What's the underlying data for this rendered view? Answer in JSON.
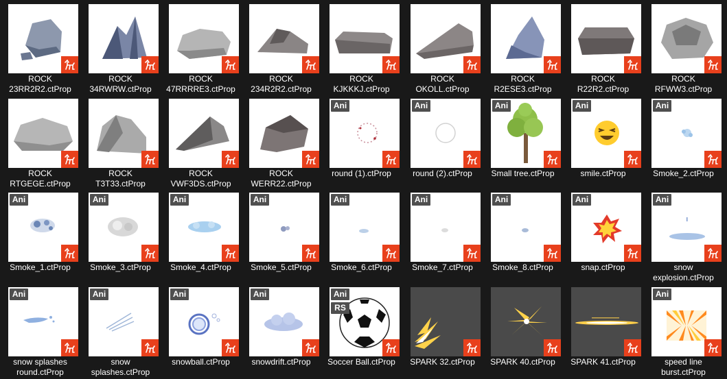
{
  "colors": {
    "background": "#191919",
    "thumb": "#ffffff",
    "badge": "#4f4f4f",
    "logo": "#e8401c"
  },
  "items": [
    {
      "lines": [
        "ROCK",
        "23RR2R2.ctProp"
      ],
      "icon": "rock-icon",
      "art": "rock1"
    },
    {
      "lines": [
        "ROCK",
        "34RWRW.ctProp"
      ],
      "icon": "rock-icon",
      "art": "rock2"
    },
    {
      "lines": [
        "ROCK",
        "47RRRRE3.ctProp"
      ],
      "icon": "rock-icon",
      "art": "rock3"
    },
    {
      "lines": [
        "ROCK",
        "234R2R2.ctProp"
      ],
      "icon": "rock-icon",
      "art": "rock4"
    },
    {
      "lines": [
        "ROCK",
        "KJKKKJ.ctProp"
      ],
      "icon": "rock-icon",
      "art": "rock5"
    },
    {
      "lines": [
        "ROCK",
        "OKOLL.ctProp"
      ],
      "icon": "rock-icon",
      "art": "rock6"
    },
    {
      "lines": [
        "ROCK",
        "R2ESE3.ctProp"
      ],
      "icon": "rock-icon",
      "art": "rock7"
    },
    {
      "lines": [
        "ROCK",
        "R22R2.ctProp"
      ],
      "icon": "rock-icon",
      "art": "rock8"
    },
    {
      "lines": [
        "ROCK",
        "RFWW3.ctProp"
      ],
      "icon": "rock-icon",
      "art": "rock9"
    },
    {
      "lines": [
        "ROCK",
        "RTGEGE.ctProp"
      ],
      "icon": "rock-icon",
      "art": "rock10"
    },
    {
      "lines": [
        "ROCK",
        "T3T33.ctProp"
      ],
      "icon": "rock-icon",
      "art": "rock11"
    },
    {
      "lines": [
        "ROCK",
        "VWF3DS.ctProp"
      ],
      "icon": "rock-icon",
      "art": "rock12"
    },
    {
      "lines": [
        "ROCK",
        "WERR22.ctProp"
      ],
      "icon": "rock-icon",
      "art": "rock13"
    },
    {
      "lines": [
        "round (1).ctProp"
      ],
      "badges": [
        "Ani"
      ],
      "icon": "dotted-circle-icon",
      "art": "round1"
    },
    {
      "lines": [
        "round (2).ctProp"
      ],
      "badges": [
        "Ani"
      ],
      "icon": "circle-icon",
      "art": "round2"
    },
    {
      "lines": [
        "Small tree.ctProp"
      ],
      "badges": [
        "Ani"
      ],
      "icon": "tree-icon",
      "art": "tree"
    },
    {
      "lines": [
        "smile.ctProp"
      ],
      "badges": [
        "Ani"
      ],
      "icon": "smile-icon",
      "art": "smile"
    },
    {
      "lines": [
        "Smoke_2.ctProp"
      ],
      "badges": [
        "Ani"
      ],
      "icon": "smoke-icon",
      "art": "smoke2"
    },
    {
      "lines": [
        "Smoke_1.ctProp"
      ],
      "badges": [
        "Ani"
      ],
      "icon": "smoke-icon",
      "art": "smoke1"
    },
    {
      "lines": [
        "Smoke_3.ctProp"
      ],
      "badges": [
        "Ani"
      ],
      "icon": "smoke-icon",
      "art": "smoke3"
    },
    {
      "lines": [
        "Smoke_4.ctProp"
      ],
      "badges": [
        "Ani"
      ],
      "icon": "smoke-icon",
      "art": "smoke4"
    },
    {
      "lines": [
        "Smoke_5.ctProp"
      ],
      "badges": [
        "Ani"
      ],
      "icon": "smoke-icon",
      "art": "smoke5"
    },
    {
      "lines": [
        "Smoke_6.ctProp"
      ],
      "badges": [
        "Ani"
      ],
      "icon": "smoke-icon",
      "art": "smoke6"
    },
    {
      "lines": [
        "Smoke_7.ctProp"
      ],
      "badges": [
        "Ani"
      ],
      "icon": "smoke-icon",
      "art": "smoke7"
    },
    {
      "lines": [
        "Smoke_8.ctProp"
      ],
      "badges": [
        "Ani"
      ],
      "icon": "smoke-icon",
      "art": "smoke8"
    },
    {
      "lines": [
        "snap.ctProp"
      ],
      "badges": [
        "Ani"
      ],
      "icon": "snap-burst-icon",
      "art": "snap"
    },
    {
      "lines": [
        "snow",
        "explosion.ctProp"
      ],
      "badges": [
        "Ani"
      ],
      "icon": "snow-icon",
      "art": "snowexp"
    },
    {
      "lines": [
        "snow splashes",
        "round.ctProp"
      ],
      "badges": [
        "Ani"
      ],
      "icon": "snow-splash-icon",
      "art": "splash1"
    },
    {
      "lines": [
        "snow",
        "splashes.ctProp"
      ],
      "badges": [
        "Ani"
      ],
      "icon": "snow-splash-icon",
      "art": "splash2"
    },
    {
      "lines": [
        "snowball.ctProp"
      ],
      "badges": [
        "Ani"
      ],
      "icon": "snowball-icon",
      "art": "snowball"
    },
    {
      "lines": [
        "snowdrift.ctProp"
      ],
      "badges": [
        "Ani"
      ],
      "icon": "snowdrift-icon",
      "art": "snowdrift"
    },
    {
      "lines": [
        "Soccer Ball.ctProp"
      ],
      "badges": [
        "Ani",
        "RS"
      ],
      "icon": "soccer-ball-icon",
      "art": "ball"
    },
    {
      "lines": [
        "SPARK 32.ctProp"
      ],
      "icon": "spark-icon",
      "art": "spark32",
      "dark": true
    },
    {
      "lines": [
        "SPARK 40.ctProp"
      ],
      "icon": "spark-icon",
      "art": "spark40",
      "dark": true
    },
    {
      "lines": [
        "SPARK 41.ctProp"
      ],
      "icon": "spark-icon",
      "art": "spark41",
      "dark": true
    },
    {
      "lines": [
        "speed line",
        "burst.ctProp"
      ],
      "badges": [
        "Ani"
      ],
      "icon": "speed-line-burst-icon",
      "art": "speedline"
    }
  ]
}
